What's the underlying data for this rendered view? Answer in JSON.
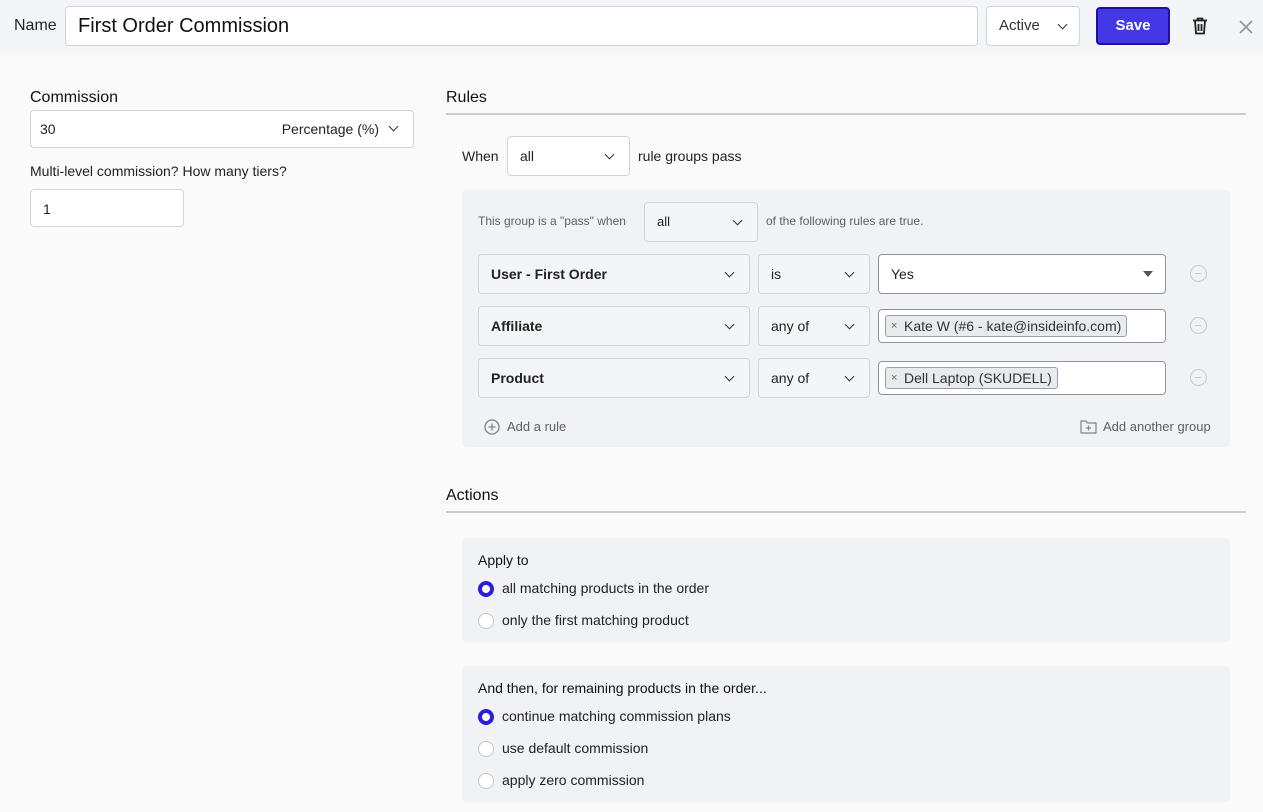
{
  "header": {
    "name_label": "Name",
    "name_value": "First Order Commission",
    "status_value": "Active",
    "save_label": "Save",
    "delete_icon": "trash-icon",
    "close_icon": "close-icon",
    "save_color": "#4438e6"
  },
  "commission": {
    "label": "Commission",
    "amount": "30",
    "type_value": "Percentage (%)",
    "tiers_label": "Multi-level commission? How many tiers?",
    "tiers_value": "1"
  },
  "rules": {
    "title": "Rules",
    "when_label": "When",
    "groups_match_value": "all",
    "groups_suffix": "rule groups pass",
    "group": {
      "prefix": "This group is a \"pass\" when",
      "match_value": "all",
      "suffix": "of the following rules are true.",
      "rows": [
        {
          "field": "User - First Order",
          "operator": "is",
          "value": "Yes"
        },
        {
          "field": "Affiliate",
          "operator": "any of",
          "tags": [
            "Kate W (#6 - kate@insideinfo.com)"
          ]
        },
        {
          "field": "Product",
          "operator": "any of",
          "tags": [
            "Dell Laptop (SKUDELL)"
          ]
        }
      ],
      "add_rule_label": "Add a rule",
      "add_group_label": "Add another group"
    }
  },
  "actions": {
    "title": "Actions",
    "apply_to": {
      "label": "Apply to",
      "options": [
        "all matching products in the order",
        "only the first matching product"
      ],
      "selected_index": 0
    },
    "remaining": {
      "label": "And then, for remaining products in the order...",
      "options": [
        "continue matching commission plans",
        "use default commission",
        "apply zero commission"
      ],
      "selected_index": 0
    }
  }
}
